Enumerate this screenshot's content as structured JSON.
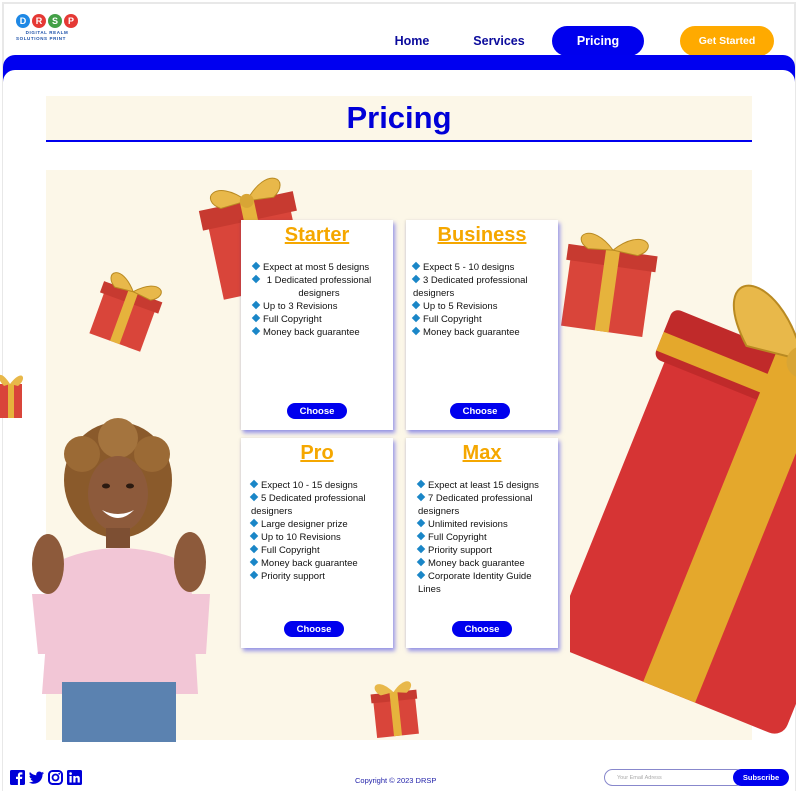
{
  "header": {
    "logo_letters": [
      "D",
      "R",
      "S",
      "P"
    ],
    "logo_colors": [
      "#1e88e5",
      "#e53935",
      "#43a047",
      "#e53935"
    ],
    "logo_subtitle_line1": "DIGITAL REALM",
    "logo_subtitle_line2": "SOLUTIONS PRINT",
    "nav": {
      "home": "Home",
      "services": "Services",
      "pricing": "Pricing"
    },
    "cta_label": "Get Started"
  },
  "main": {
    "title": "Pricing",
    "plans": [
      {
        "name": "Starter",
        "features": [
          "Expect at most 5 designs",
          "1 Dedicated professional designers",
          "Up to 3 Revisions",
          "Full Copyright",
          "Money back guarantee"
        ],
        "button": "Choose"
      },
      {
        "name": "Business",
        "features": [
          "Expect 5 - 10 designs",
          "3 Dedicated professional designers",
          "Up to 5 Revisions",
          "Full Copyright",
          "Money back guarantee"
        ],
        "button": "Choose"
      },
      {
        "name": "Pro",
        "features": [
          "Expect 10 - 15 designs",
          "5 Dedicated professional designers",
          "Large designer prize",
          "Up to 10 Revisions",
          "Full Copyright",
          "Money back guarantee",
          "Priority support"
        ],
        "button": "Choose"
      },
      {
        "name": "Max",
        "features": [
          "Expect at least 15 designs",
          "7 Dedicated professional designers",
          "Unlimited revisions",
          "Full Copyright",
          "Priority support",
          "Money back guarantee",
          "Corporate Identity Guide Lines"
        ],
        "button": "Choose"
      }
    ]
  },
  "footer": {
    "social_icons": [
      "facebook-icon",
      "twitter-icon",
      "instagram-icon",
      "linkedin-icon"
    ],
    "copyright": "Copyright © 2023 DRSP",
    "email_placeholder": "Your Email Adress",
    "subscribe_label": "Subscribe"
  },
  "colors": {
    "primary": "#0000ee",
    "accent": "#ffaa00",
    "cream": "#fcf7e8",
    "plan_title": "#f5a700"
  }
}
